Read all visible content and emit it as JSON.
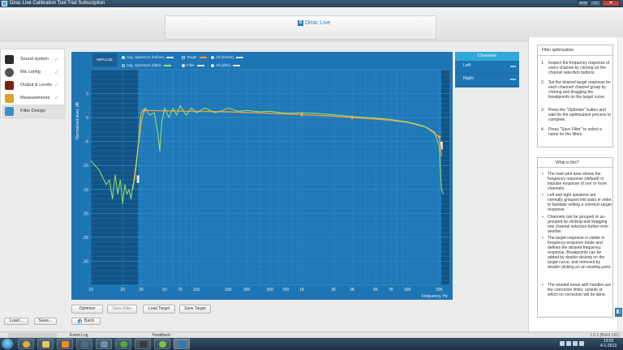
{
  "window": {
    "title": "Dirac Live Calibration Tool Trial Subscription",
    "buttons": {
      "restore": "⟷",
      "minimize": "▭",
      "close": "✕"
    }
  },
  "header": {
    "logo_text": "Dirac Live",
    "logo_mark": "D"
  },
  "sidebar": {
    "items": [
      {
        "label": "Sound system",
        "icon": "speaker-icon",
        "done": true
      },
      {
        "label": "Mic config",
        "icon": "microphone-icon",
        "done": true
      },
      {
        "label": "Output & Levels",
        "icon": "speaker-levels-icon",
        "done": true
      },
      {
        "label": "Measurements",
        "icon": "measurements-icon",
        "done": true
      },
      {
        "label": "Filter Design",
        "icon": "filter-design-icon",
        "done": false,
        "active": true
      }
    ],
    "load_label": "Load...",
    "save_label": "Save..."
  },
  "plot": {
    "impulse_tab": "IMPULSE",
    "legend": [
      {
        "label": "Avg. Spectrum (before)",
        "color": "#d7e7f3",
        "checked": false
      },
      {
        "label": "Target",
        "color": "#f29a3e",
        "checked": true
      },
      {
        "label": "All (before)",
        "color": "#d7e7f3",
        "checked": false
      },
      {
        "label": "Avg. Spectrum (after)",
        "color": "#9be36a",
        "checked": true
      },
      {
        "label": "Filter",
        "color": "#d7e7f3",
        "checked": false
      },
      {
        "label": "All (after)",
        "color": "#d7e7f3",
        "checked": false
      }
    ],
    "ylabel": "Normalized level, dB",
    "xlabel": "Frequency, Hz"
  },
  "chart_data": {
    "type": "line",
    "title": "",
    "xlabel": "Frequency, Hz",
    "ylabel": "Normalized level, dB",
    "x_scale": "log",
    "xlim": [
      10,
      25000
    ],
    "ylim": [
      -35,
      10
    ],
    "x_ticks": [
      10,
      20,
      30,
      50,
      70,
      100,
      200,
      300,
      500,
      700,
      1000,
      2000,
      3000,
      5000,
      7000,
      10000,
      20000
    ],
    "x_tick_labels": [
      "10",
      "20",
      "30",
      "50",
      "70",
      "100",
      "200",
      "300",
      "500",
      "700",
      "1K",
      "2K",
      "3K",
      "5K",
      "7K",
      "10K",
      "20K"
    ],
    "y_ticks": [
      5,
      0,
      -5,
      -10,
      -15,
      -20,
      -25,
      -30
    ],
    "y_tick_labels": [
      "5",
      "0",
      "-5",
      "-10",
      "-15",
      "-20",
      "-25",
      "-30"
    ],
    "grid": true,
    "correction_limits_hz": [
      28,
      21000
    ],
    "series": [
      {
        "name": "Target",
        "color": "#f29a3e",
        "x": [
          25,
          30,
          32,
          50,
          100,
          200,
          500,
          1000,
          2000,
          3000,
          5000,
          7000,
          10000,
          15000,
          20000,
          21000
        ],
        "y": [
          -15,
          -1,
          1.5,
          1.4,
          1.3,
          1.2,
          0.9,
          0.6,
          0.3,
          0.0,
          -0.3,
          -0.6,
          -1.0,
          -2.0,
          -4.0,
          -8.0
        ],
        "breakpoints_x": [
          32,
          1000,
          3000,
          20000
        ]
      },
      {
        "name": "Avg. Spectrum (after)",
        "color": "#9be36a",
        "x": [
          10,
          12,
          14,
          15,
          16,
          17,
          18,
          19,
          20,
          21,
          22,
          23,
          24,
          25,
          26,
          27,
          28,
          29,
          30,
          33,
          36,
          40,
          43,
          45,
          47,
          50,
          55,
          60,
          65,
          70,
          80,
          90,
          100,
          120,
          150,
          180,
          200,
          250,
          300,
          400,
          500,
          700,
          1000,
          1500,
          2000,
          3000,
          5000,
          7000,
          10000,
          13000,
          15000,
          18000,
          20000,
          21000,
          22000
        ],
        "y": [
          -9,
          -11,
          -14,
          -13,
          -17,
          -12,
          -16,
          -13,
          -18,
          -14,
          -16,
          -15,
          -17,
          -14,
          -13,
          -10,
          -6,
          -2,
          1,
          2,
          0.5,
          1,
          -3,
          -7,
          -1,
          2,
          0,
          2,
          0.5,
          2.5,
          0.5,
          2,
          1,
          2,
          1,
          1.5,
          2,
          1.3,
          1.5,
          1.2,
          1.3,
          0.9,
          1.0,
          0.8,
          0.6,
          0.2,
          -0.1,
          -0.4,
          -0.9,
          -1.5,
          -2,
          -3,
          -6,
          -15,
          -16
        ]
      }
    ]
  },
  "actions": {
    "optimize": "Optimize",
    "save_filter": "Save Filter",
    "load_target": "Load Target",
    "save_target": "Save Target",
    "back": "Back"
  },
  "channels": {
    "header": "Channels",
    "items": [
      "Left",
      "Right"
    ]
  },
  "help": {
    "title": "Filter optimization",
    "steps": [
      {
        "n": "1.",
        "text": "Inspect the frequency response of every channel by clicking on the channel selection buttons."
      },
      {
        "n": "2.",
        "text": "Set the desired target response for each channel/ channel group by clicking and dragging the breakpoints on the target curve."
      },
      {
        "n": "3.",
        "text": "Press the \"Optimize\" button and wait for the optimization process to complete."
      },
      {
        "n": "4.",
        "text": "Press \"Save Filter\" to select a name for the filters."
      }
    ],
    "what_title": "What is this?",
    "bullets": [
      "The main plot area shows the frequency response (default) or impulse response of one or more channels.",
      "Left and right speakers are normally grouped into pairs in order to facilitate setting a common target response.",
      "Channels can be grouped or un-grouped by clicking and dragging one channel selection button onto another.",
      "The target response is visible in frequency-response mode and defines the desired frequency response. Breakpoints can be added by double-clicking on the target curve, and removed by double clicking on an existing point.",
      "The shaded areas with handles are the correction limits; outside of which no correction will be done."
    ]
  },
  "statusbar": {
    "event_log": "Event Log",
    "feedback": "Feedback",
    "version": "1.0.1 (Build 161)"
  },
  "taskbar": {
    "time": "13:03",
    "date": "4-1-2013"
  }
}
